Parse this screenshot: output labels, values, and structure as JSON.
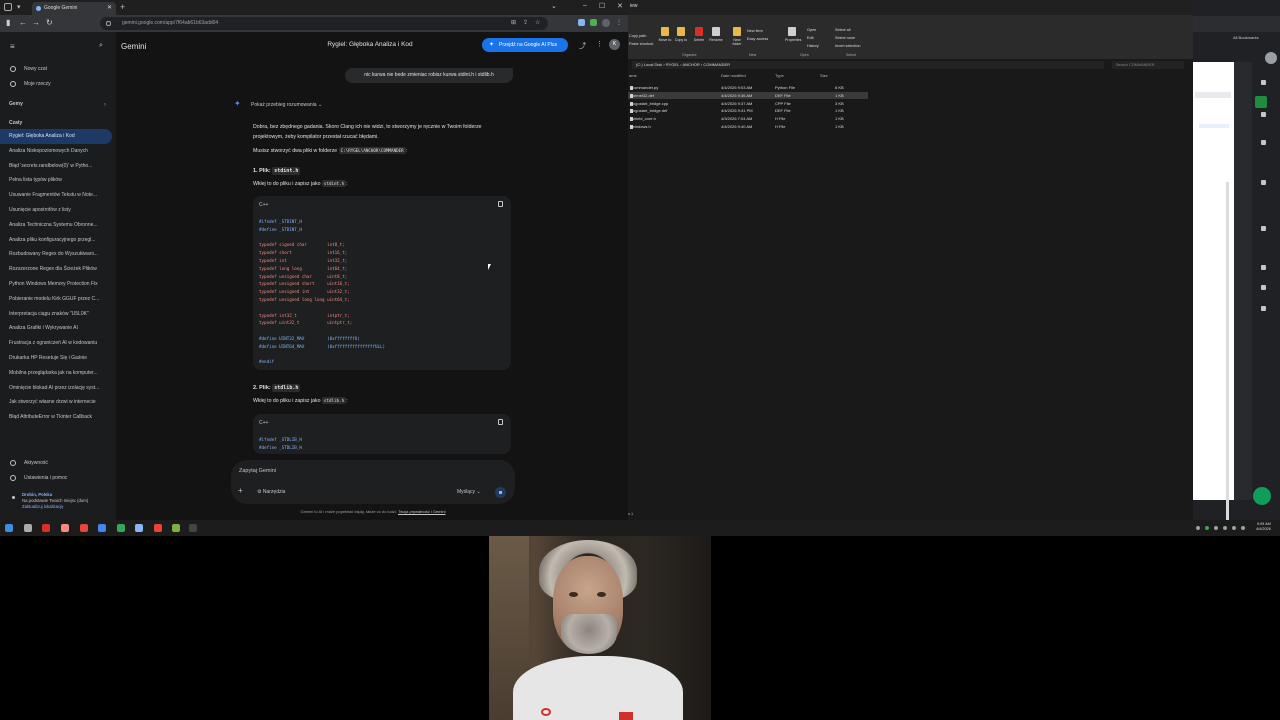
{
  "browser": {
    "tab_title": "Google Gemini",
    "url": "gemini.google.com/app/7f64ab61b63add04"
  },
  "gemini": {
    "brand": "Gemini",
    "chat_title": "Rygiel: Głęboka Analiza i Kod",
    "ai_plus_label": "Przejdź na Google AI Plus",
    "user_initial": "K",
    "new_chat": "Nowy czat",
    "my_stuff": "Moje rzeczy",
    "gems": "Gemy",
    "chats_header": "Czaty",
    "chats": [
      "Rygiel: Głęboka Analiza i Kod",
      "Analiza Niskopoziomowych Danych",
      "Błąd 'secrets.randbelow(0)' w Pytho...",
      "Pełna lista typów plików",
      "Usuwanie Fragmentów Tekstu w Note...",
      "Usunięcie apostrofów z listy",
      "Analiza Techniczna Systemu Obronne...",
      "Analiza pliku konfiguracyjnego przegl...",
      "Rozbudowany Regex do Wyszukiwani...",
      "Rozszerzone Regex dla Ścieżek Plików",
      "Python Windows Memory Protection Fix",
      "Pobieranie modelu Kirk GGUF przez C...",
      "Interpretacja ciągu znaków \"U5L0K\"",
      "Analiza Grafiki i Wykrywanie AI",
      "Frustracja z ograniczeń AI w kodowaniu",
      "Drukarka HP Resetuje Się i Gaśnie",
      "Mobilna przeglądarka jak na komputer...",
      "Ominięcie blokad AI przez izolację syst...",
      "Jak stworzyć własne drzwi w internecie",
      "Błąd AttributeError w Tkinter Callback"
    ],
    "activity": "Aktywność",
    "settings": "Ustawienia i pomoc",
    "location_place": "Drobin, Polska",
    "location_note": "Na podstawie Twoich miejsc (dom)",
    "location_update": "Zaktualizuj lokalizację",
    "user_message": "nic kurwa nie bede zmieniac robisz kurwa stdint.h i stdlib.h",
    "reasoning_label": "Pokaż przebieg rozumowania",
    "answer_p1": "Dobra, bez zbędnego gadania. Skoro Clang ich nie widzi, to stworzymy je ręcznie w Twoim folderze projektowym, żeby kompilator przestał rzucać błędami.",
    "answer_p2_pre": "Musisz stworzyć dwa pliki w folderze",
    "answer_p2_code": "C:\\RYGEL\\ANCHOR\\COMMANDER",
    "answer_p2_post": ":",
    "file1_prefix": "1. Plik:",
    "file1_name": "stdint.h",
    "file1_instr_pre": "Wklej to do pliku i zapisz jako",
    "file1_instr_code": "stdint.h",
    "file1_instr_post": ":",
    "file2_prefix": "2. Plik:",
    "file2_name": "stdlib.h",
    "file2_instr_pre": "Wklej to do pliku i zapisz jako",
    "file2_instr_code": "stdlib.h",
    "file2_instr_post": ":",
    "code_lang": "C++",
    "code1_lines": [
      "#ifndef _STDINT_H",
      "#define _STDINT_H",
      "",
      "typedef signed char        int8_t;",
      "typedef short              int16_t;",
      "typedef int                int32_t;",
      "typedef long long          int64_t;",
      "typedef unsigned char      uint8_t;",
      "typedef unsigned short     uint16_t;",
      "typedef unsigned int       uint32_t;",
      "typedef unsigned long long uint64_t;",
      "",
      "typedef int32_t            intptr_t;",
      "typedef uint32_t           uintptr_t;",
      "",
      "#define UINT32_MAX         (0xffffffffU)",
      "#define UINT64_MAX         (0xffffffffffffffffULL)",
      "",
      "#endif"
    ],
    "code2_lines": [
      "#ifndef _STDLIB_H",
      "#define _STDLIB_H"
    ],
    "prompt_placeholder": "Zapytaj Gemini",
    "tools_label": "Narzędzia",
    "mode_label": "Myślący",
    "disclaimer_text": "Gemini to AI i może popełniać błędy, także co do ludzi.",
    "disclaimer_link": "Twoja prywatność i Gemini"
  },
  "explorer": {
    "window_title": "iew",
    "ribbon": {
      "copy_path": "Copy path",
      "paste_shortcut": "Paste shortcut",
      "move_to": "Move to",
      "copy_to": "Copy to",
      "delete": "Delete",
      "rename": "Rename",
      "new_folder": "New folder",
      "new_item": "New item",
      "easy_access": "Easy access",
      "properties": "Properties",
      "open": "Open",
      "edit": "Edit",
      "history": "History",
      "select_all": "Select all",
      "select_none": "Select none",
      "invert_selection": "Invert selection",
      "group_organize": "Organize",
      "group_new": "New",
      "group_open": "Open",
      "group_select": "Select"
    },
    "path": "(C:) Local Disk  ›  RYGEL  ›  ANCHOR  ›  COMMANDER",
    "search_placeholder": "Search COMMANDER",
    "columns": [
      "ame",
      "Date modified",
      "Type",
      "Size"
    ],
    "files": [
      {
        "name": "commander.py",
        "date": "4/4/2026 9:03 AM",
        "type": "Python File",
        "size": "8 KB",
        "selected": false
      },
      {
        "name": "kernel32.def",
        "date": "4/4/2026 9:36 AM",
        "type": "DEF File",
        "size": "1 KB",
        "selected": true
      },
      {
        "name": "logostart_bridge.cpp",
        "date": "4/4/2026 9:37 AM",
        "type": "CPP File",
        "size": "3 KB",
        "selected": false
      },
      {
        "name": "logostart_bridge.def",
        "date": "4/4/2026 9:41 PM",
        "type": "DEF File",
        "size": "1 KB",
        "selected": false
      },
      {
        "name": "shield_core.h",
        "date": "4/3/2026 7:04 AM",
        "type": "H File",
        "size": "1 KB",
        "selected": false
      },
      {
        "name": "windows.h",
        "date": "4/4/2026 9:40 AM",
        "type": "H File",
        "size": "1 KB",
        "selected": false
      }
    ],
    "status": "s  1"
  },
  "right_window": {
    "bookmarks_label": "All Bookmarks"
  },
  "taskbar": {
    "time": "9:09 AM",
    "date": "4/4/2026"
  }
}
